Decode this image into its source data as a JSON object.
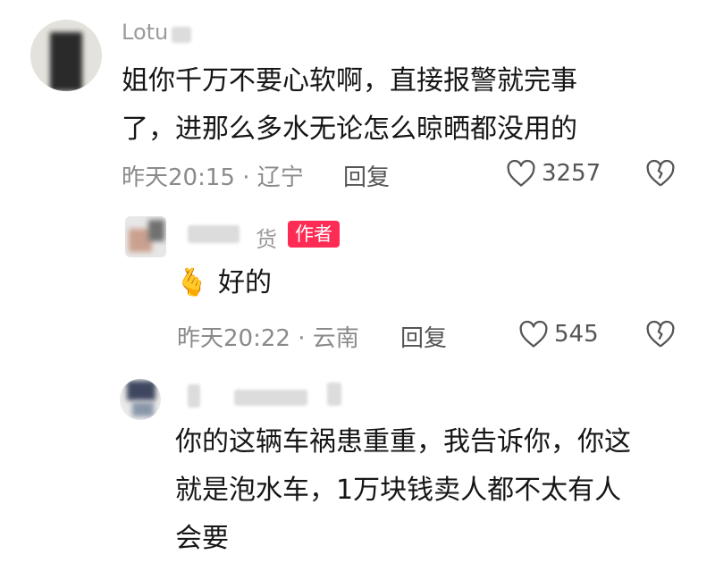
{
  "comments": [
    {
      "username": "Lotu",
      "text_line1": "姐你千万不要心软啊，直接报警就完事",
      "text_line2": "了，进那么多水无论怎么晾晒都没用的",
      "meta": "昨天20:15 · 辽宁",
      "reply_label": "回复",
      "likes": "3257",
      "avatar_color": "#6d6d6d"
    },
    {
      "username": "货",
      "badge": "作者",
      "emoji": "🫰",
      "text": "好的",
      "meta": "昨天20:22 · 云南",
      "reply_label": "回复",
      "likes": "545",
      "badge_color": "#fe2c55"
    },
    {
      "text_line1": "你的这辆车祸患重重，我告诉你，你这",
      "text_line2": "就是泡水车，1万块钱卖人都不太有人",
      "text_line3": "会要"
    }
  ]
}
